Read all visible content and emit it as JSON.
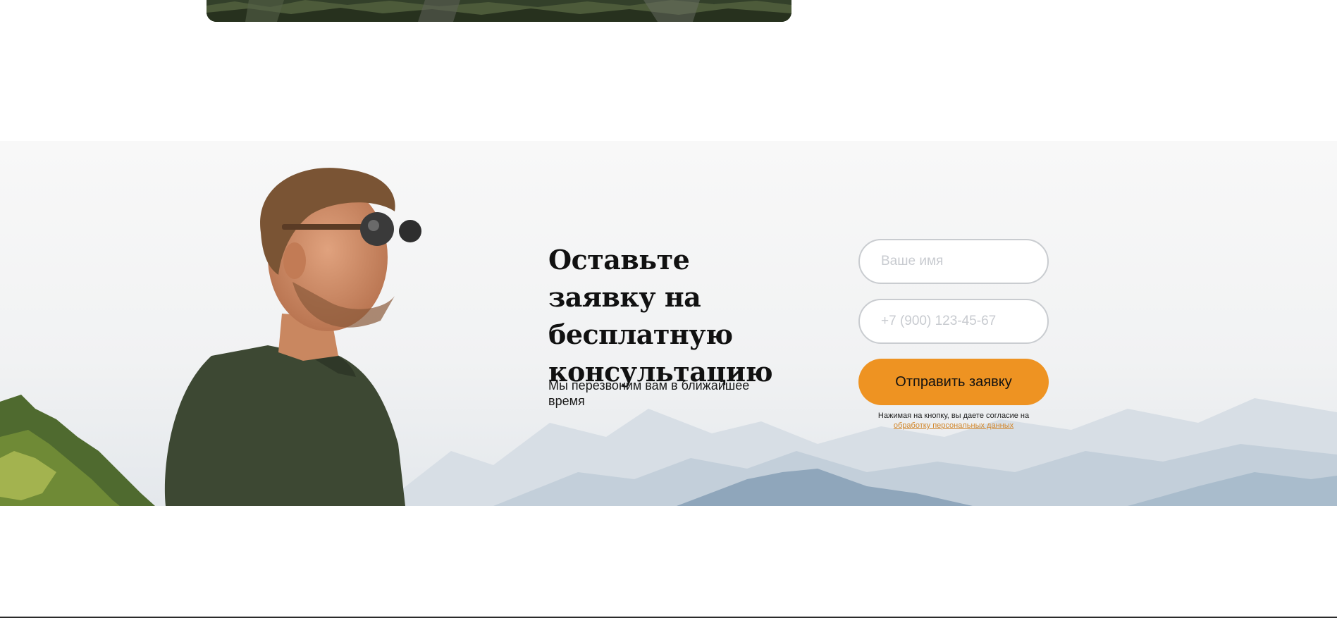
{
  "consultation": {
    "title": "Оставьте заявку на бесплатную консультацию",
    "subtitle": "Мы перезвоним вам в ближайшее время",
    "form": {
      "name_placeholder": "Ваше имя",
      "phone_placeholder": "+7 (900) 123-45-67",
      "submit_label": "Отправить заявку",
      "consent_text": "Нажимая на кнопку, вы даете согласие на",
      "consent_link": "обработку персональных данных"
    }
  },
  "colors": {
    "accent": "#ee9322",
    "link": "#d1862a",
    "field_border": "#c9ccd0",
    "text": "#111111"
  }
}
